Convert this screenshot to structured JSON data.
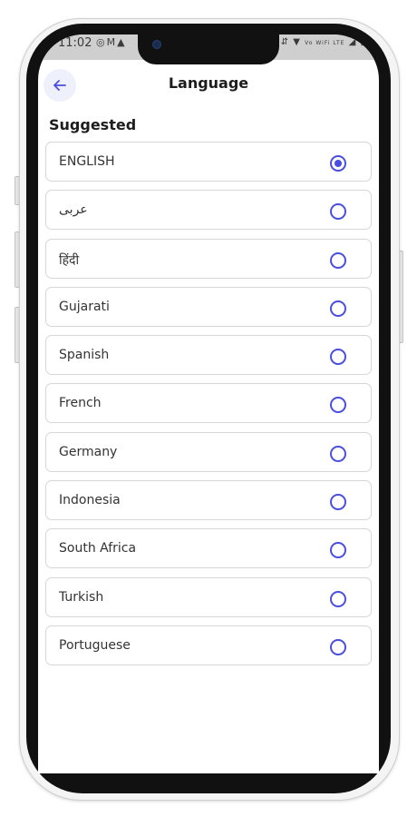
{
  "status_bar": {
    "time": "11:02",
    "left_icons": [
      "instagram-icon",
      "gmail-icon",
      "notification-icon"
    ],
    "right_text": "Vo WiFi LTE"
  },
  "header": {
    "title": "Language"
  },
  "section": {
    "title": "Suggested"
  },
  "languages": [
    {
      "label": "ENGLISH",
      "selected": true
    },
    {
      "label": "عربى",
      "selected": false
    },
    {
      "label": "हिंदी",
      "selected": false
    },
    {
      "label": "Gujarati",
      "selected": false
    },
    {
      "label": "Spanish",
      "selected": false
    },
    {
      "label": "French",
      "selected": false
    },
    {
      "label": "Germany",
      "selected": false
    },
    {
      "label": "Indonesia",
      "selected": false
    },
    {
      "label": "South Africa",
      "selected": false
    },
    {
      "label": "Turkish",
      "selected": false
    },
    {
      "label": "Portuguese",
      "selected": false
    }
  ],
  "colors": {
    "accent": "#4a4ee0",
    "back_button_bg": "#eef0fb",
    "border": "#d6d6d6"
  }
}
